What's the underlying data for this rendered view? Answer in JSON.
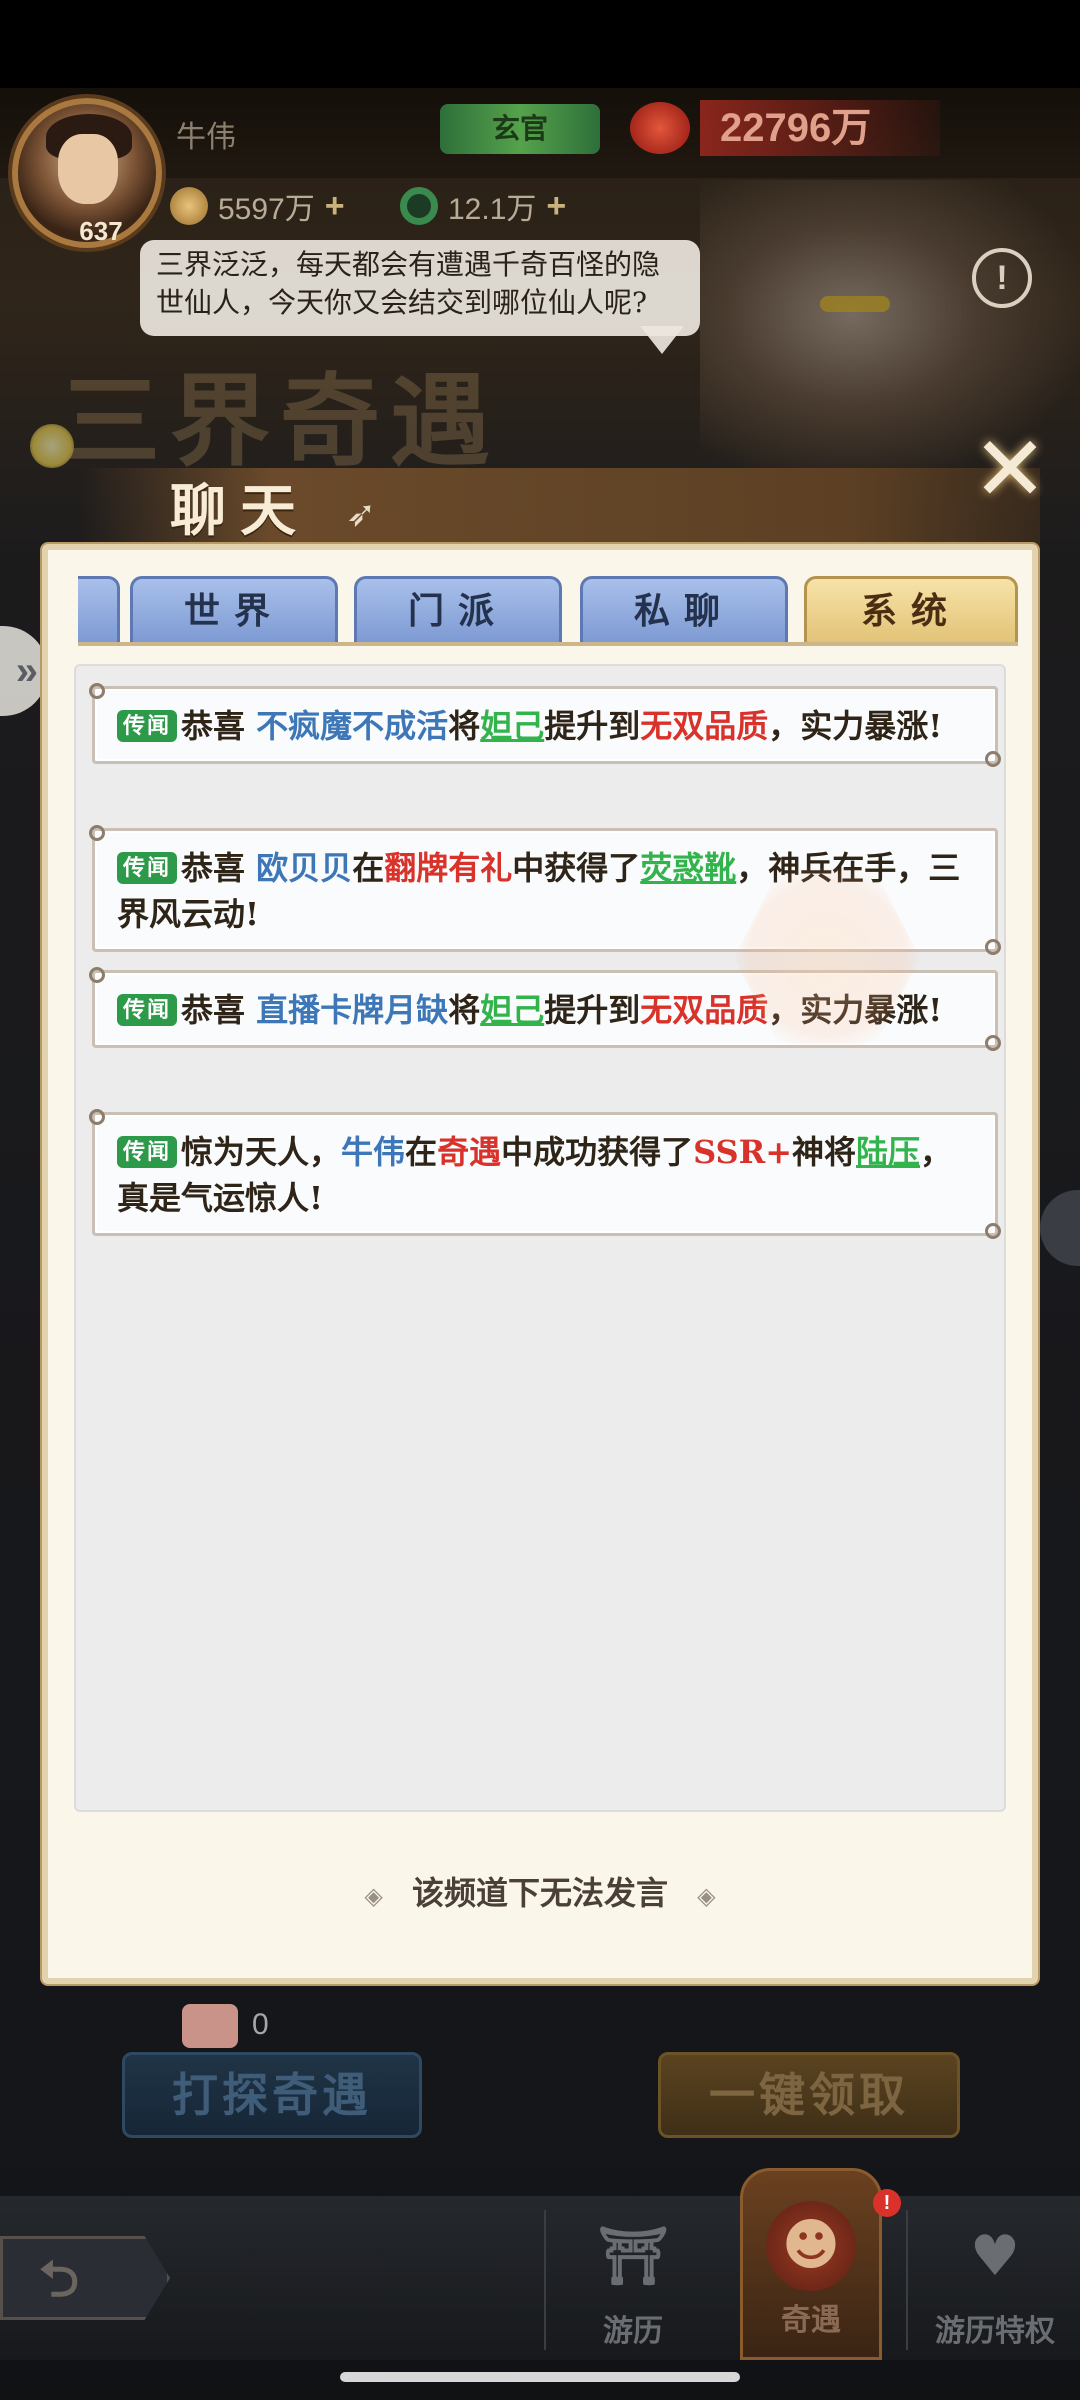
{
  "header": {
    "player_name": "牛伟",
    "rank": "玄官",
    "power": "22796万",
    "level": "637",
    "currency_coins": "5597万",
    "currency_jade": "12.1万",
    "plus_glyph": "+",
    "bubble_text": "三界泛泛，每天都会有遭遇千奇百怪的隐世仙人，今天你又会结交到哪位仙人呢?",
    "event_title": "三界奇遇",
    "alert_glyph": "!"
  },
  "chat": {
    "title": "聊天",
    "close_glyph": "✕",
    "tabs": [
      {
        "label": "世界",
        "active": false
      },
      {
        "label": "门派",
        "active": false
      },
      {
        "label": "私聊",
        "active": false
      },
      {
        "label": "系统",
        "active": true
      }
    ],
    "messages": [
      {
        "tag": "传闻",
        "parts": [
          {
            "text": "恭喜 ",
            "style": "plain"
          },
          {
            "text": "不疯魔不成活",
            "style": "name"
          },
          {
            "text": "将",
            "style": "plain"
          },
          {
            "text": "妲己",
            "style": "link"
          },
          {
            "text": "提升到",
            "style": "plain"
          },
          {
            "text": "无双品质",
            "style": "red"
          },
          {
            "text": "，实力暴涨!",
            "style": "plain"
          }
        ]
      },
      {
        "tag": "传闻",
        "parts": [
          {
            "text": "恭喜 ",
            "style": "plain"
          },
          {
            "text": "欧贝贝",
            "style": "name"
          },
          {
            "text": "在",
            "style": "plain"
          },
          {
            "text": "翻牌有礼",
            "style": "red"
          },
          {
            "text": "中获得了",
            "style": "plain"
          },
          {
            "text": "荧惑靴",
            "style": "link"
          },
          {
            "text": "，神兵在手，三界风云动!",
            "style": "plain"
          }
        ]
      },
      {
        "tag": "传闻",
        "parts": [
          {
            "text": "恭喜 ",
            "style": "plain"
          },
          {
            "text": "直播卡牌月缺",
            "style": "name"
          },
          {
            "text": "将",
            "style": "plain"
          },
          {
            "text": "妲己",
            "style": "link"
          },
          {
            "text": "提升到",
            "style": "plain"
          },
          {
            "text": "无双品质",
            "style": "red"
          },
          {
            "text": "，实力暴涨!",
            "style": "plain"
          }
        ]
      },
      {
        "tag": "传闻",
        "parts": [
          {
            "text": "惊为天人，",
            "style": "plain"
          },
          {
            "text": "牛伟",
            "style": "name"
          },
          {
            "text": "在",
            "style": "plain"
          },
          {
            "text": "奇遇",
            "style": "red"
          },
          {
            "text": "中成功获得了",
            "style": "plain"
          },
          {
            "text": "SSR+",
            "style": "red"
          },
          {
            "text": "神将",
            "style": "plain"
          },
          {
            "text": "陆压",
            "style": "link"
          },
          {
            "text": "，真是气运惊人!",
            "style": "plain"
          }
        ]
      }
    ],
    "footer_note": "该频道下无法发言",
    "footer_deco": "◈"
  },
  "actions": {
    "counter_value": "0",
    "explore_label": "打探奇遇",
    "claim_label": "一键领取"
  },
  "bottom_nav": {
    "back_glyph": "⮌",
    "items": [
      {
        "label": "游历",
        "icon": "shrine-icon",
        "glyph": "⛩",
        "active": false
      },
      {
        "label": "奇遇",
        "icon": "mask-icon",
        "glyph": "☻",
        "active": true,
        "badge": "!"
      },
      {
        "label": "游历特权",
        "icon": "heart-emblem-icon",
        "glyph": "♥",
        "active": false
      }
    ]
  },
  "colors": {
    "tag_green": "#2d9a4a",
    "name_blue": "#3d77b8",
    "highlight_red": "#d8322a",
    "link_green": "#32b34c",
    "active_tab_gold": "#e2c276",
    "inactive_tab_blue": "#7d99d3"
  }
}
